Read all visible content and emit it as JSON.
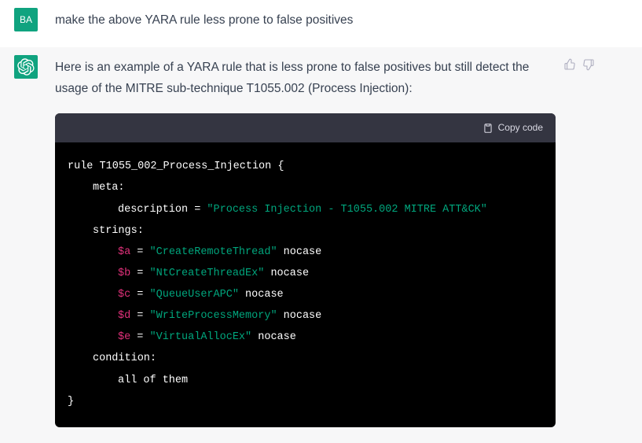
{
  "user": {
    "avatar_initials": "BA",
    "prompt": "make the above YARA rule less prone to false positives"
  },
  "assistant": {
    "intro": "Here is an example of a YARA rule that is less prone to false positives but still detect the usage of the MITRE sub-technique T1055.002 (Process Injection):",
    "copy_label": "Copy code",
    "code": {
      "rule_kw": "rule",
      "rule_name": "T1055_002_Process_Injection {",
      "meta_kw": "meta:",
      "desc_key": "description = ",
      "desc_val": "\"Process Injection - T1055.002 MITRE ATT&CK\"",
      "strings_kw": "strings:",
      "a_var": "$a",
      "a_eq": " = ",
      "a_str": "\"CreateRemoteThread\"",
      "a_mod": " nocase",
      "b_var": "$b",
      "b_str": "\"NtCreateThreadEx\"",
      "c_var": "$c",
      "c_str": "\"QueueUserAPC\"",
      "d_var": "$d",
      "d_str": "\"WriteProcessMemory\"",
      "e_var": "$e",
      "e_str": "\"VirtualAllocEx\"",
      "eq": " = ",
      "nocase": " nocase",
      "cond_kw": "condition:",
      "cond_body": "all of them",
      "close": "}"
    }
  }
}
